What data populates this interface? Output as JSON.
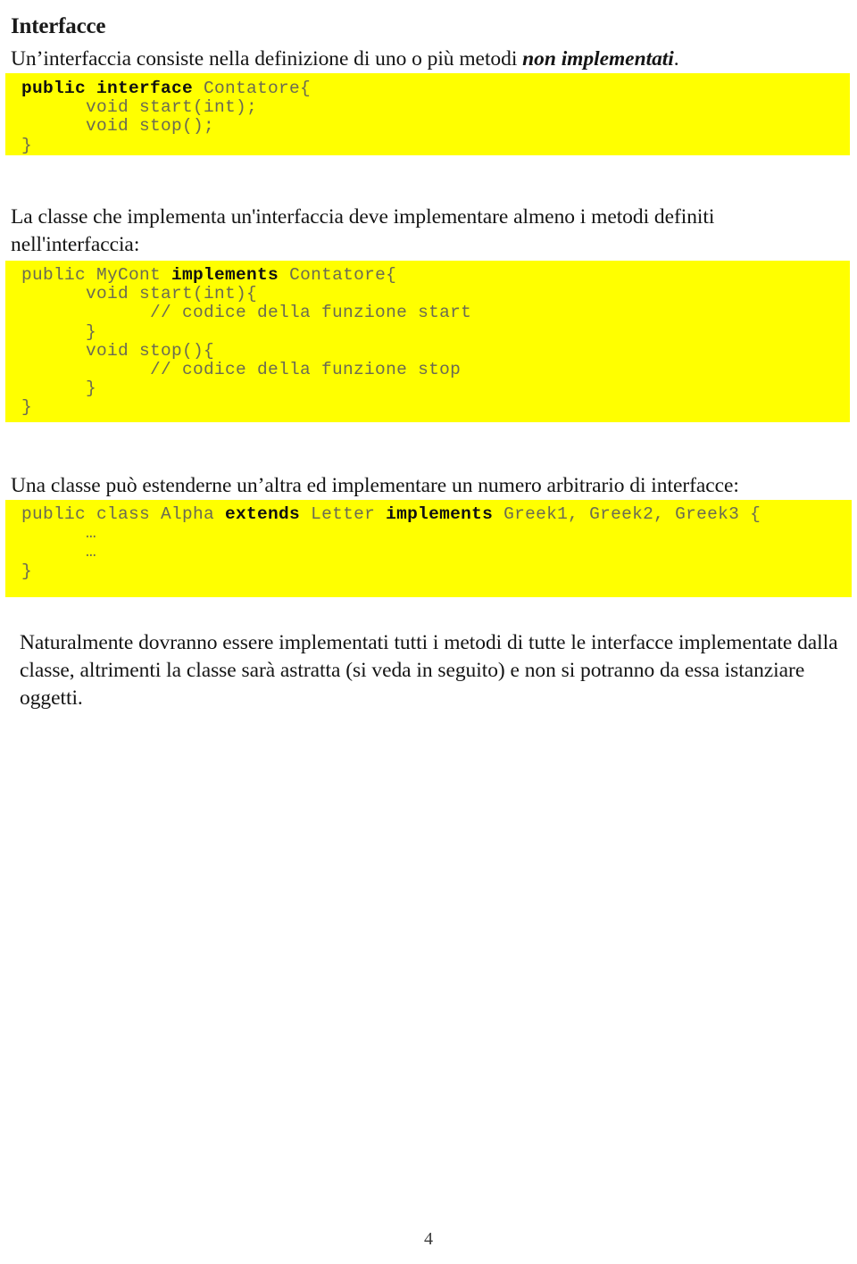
{
  "document": {
    "title": "Interfacce",
    "page_number": "4",
    "highlight_color": "#ffff00",
    "code_text_color": "#6b6b52",
    "keyword_color": "#111111"
  },
  "paragraphs": {
    "intro_prefix": "Un’interfaccia consiste nella definizione di uno o più metodi ",
    "intro_emphasis": "non implementati",
    "intro_suffix": ".",
    "second": "La classe che implementa un'interfaccia deve implementare almeno i metodi definiti nell'interfaccia:",
    "third": "Una classe può estenderne un’altra ed implementare un numero arbitrario di interfacce:",
    "final": "Naturalmente dovranno essere implementati tutti i metodi di tutte le interfacce implementate dalla classe, altrimenti la classe sarà astratta (si veda in seguito) e non si potranno da essa istanziare oggetti."
  },
  "code_blocks": {
    "interface": {
      "line1_keyword": "public interface",
      "line1_rest": " Contatore{",
      "line2": "      void start(int);",
      "line3": "      void stop();",
      "line4": "}"
    },
    "mycont": {
      "line1_a": "public MyCont ",
      "line1_keyword": "implements",
      "line1_b": " Contatore{",
      "line2": "      void start(int){",
      "line3": "            // codice della funzione start",
      "line4": "      }",
      "line5": "      void stop(){",
      "line6": "            // codice della funzione stop",
      "line7": "      }",
      "line8": "}"
    },
    "alpha": {
      "line1_a": "public class Alpha ",
      "line1_kw1": "extends",
      "line1_b": " Letter ",
      "line1_kw2": "implements",
      "line1_c": " Greek1, Greek2, Greek3 {",
      "line2": "      …",
      "line3": "      …",
      "line4": "}"
    }
  }
}
